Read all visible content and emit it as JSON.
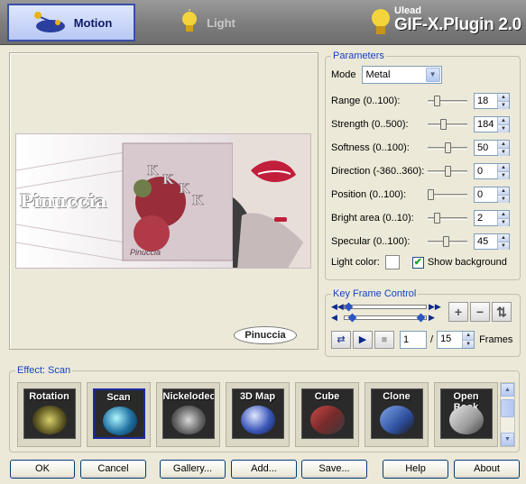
{
  "tabs": {
    "motion": "Motion",
    "light": "Light"
  },
  "brand": {
    "small": "Ulead",
    "big": "GIF-X.Plugin 2.0"
  },
  "preview": {
    "badge": "Pinuccia",
    "watermark": "Pinuccia",
    "sign": "Pinuccia"
  },
  "parameters": {
    "title": "Parameters",
    "mode_label": "Mode",
    "mode_value": "Metal",
    "rows": [
      {
        "label": "Range (0..100):",
        "value": "18",
        "pct": 18
      },
      {
        "label": "Strength (0..500):",
        "value": "184",
        "pct": 36.8
      },
      {
        "label": "Softness (0..100):",
        "value": "50",
        "pct": 50
      },
      {
        "label": "Direction (-360..360):",
        "value": "0",
        "pct": 50
      },
      {
        "label": "Position (0..100):",
        "value": "0",
        "pct": 0
      },
      {
        "label": "Bright area (0..10):",
        "value": "2",
        "pct": 20
      },
      {
        "label": "Specular (0..100):",
        "value": "45",
        "pct": 45
      }
    ],
    "light_color_label": "Light color:",
    "light_color": "#ffffff",
    "show_background_label": "Show background",
    "show_background_checked": true
  },
  "keyframe": {
    "title": "Key Frame Control",
    "current_frame": "1",
    "total_frames": "15",
    "frames_label": "Frames"
  },
  "effect": {
    "title": "Effect: Scan",
    "items": [
      {
        "label": "Rotation"
      },
      {
        "label": "Scan"
      },
      {
        "label": "Nickelodeon"
      },
      {
        "label": "3D Map"
      },
      {
        "label": "Cube"
      },
      {
        "label": "Clone"
      },
      {
        "label": "Open Book"
      }
    ]
  },
  "buttons": {
    "ok": "OK",
    "cancel": "Cancel",
    "gallery": "Gallery...",
    "add": "Add...",
    "save": "Save...",
    "help": "Help",
    "about": "About"
  }
}
